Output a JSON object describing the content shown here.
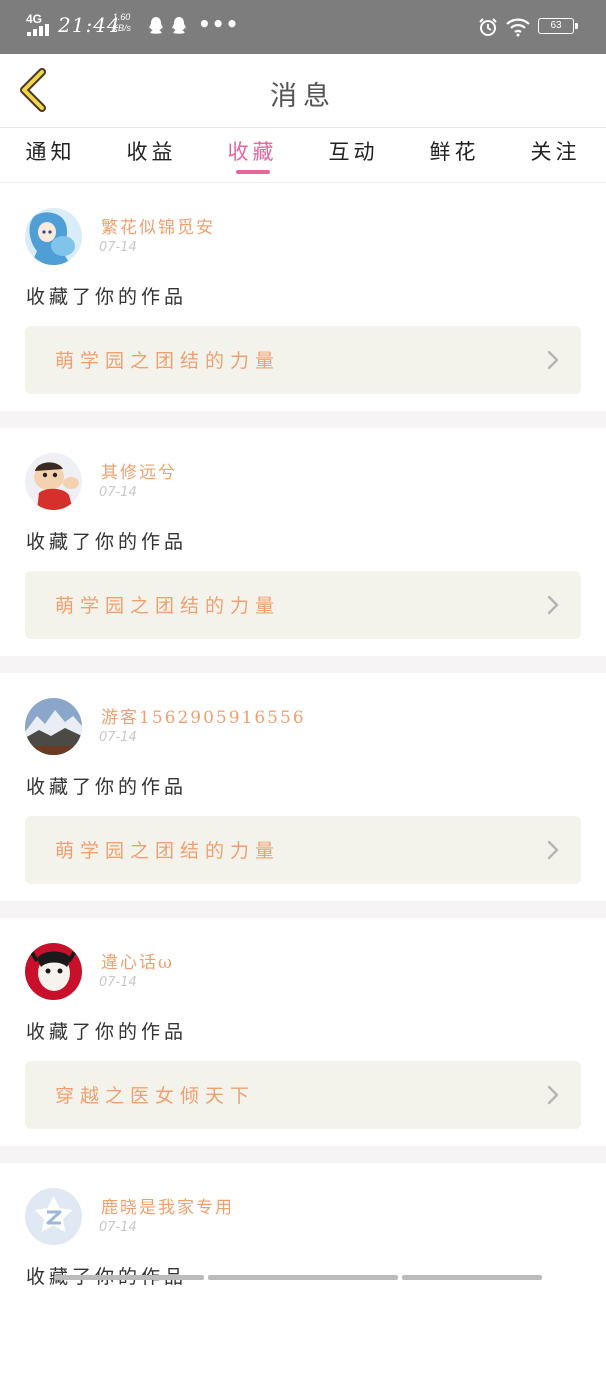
{
  "status_bar": {
    "network": "4G",
    "time": "21:44",
    "speed_value": "1.60",
    "speed_unit": "KB/s",
    "more": "•••",
    "battery": "63"
  },
  "header": {
    "title": "消息"
  },
  "tabs": [
    {
      "label": "通知",
      "active": false
    },
    {
      "label": "收益",
      "active": false
    },
    {
      "label": "收藏",
      "active": true
    },
    {
      "label": "互动",
      "active": false
    },
    {
      "label": "鲜花",
      "active": false
    },
    {
      "label": "关注",
      "active": false
    }
  ],
  "accent_color": "#e8669b",
  "name_color": "#f0a070",
  "messages": [
    {
      "user": "繁花似锦觅安",
      "date": "07-14",
      "action": "收藏了你的作品",
      "work": "萌学园之团结的力量",
      "avatar": "blue-haired-anime-girl-avatar"
    },
    {
      "user": "其修远兮",
      "date": "07-14",
      "action": "收藏了你的作品",
      "work": "萌学园之团结的力量",
      "avatar": "cartoon-boy-avatar"
    },
    {
      "user": "游客1562905916556",
      "date": "07-14",
      "action": "收藏了你的作品",
      "work": "萌学园之团结的力量",
      "avatar": "snow-mountain-avatar"
    },
    {
      "user": "違心话ω",
      "date": "07-14",
      "action": "收藏了你的作品",
      "work": "穿越之医女倾天下",
      "avatar": "red-panda-girl-avatar"
    },
    {
      "user": "鹿晓是我家专用",
      "date": "07-14",
      "action": "收藏了你的作品",
      "work": "",
      "avatar": "default-qq-avatar"
    }
  ]
}
